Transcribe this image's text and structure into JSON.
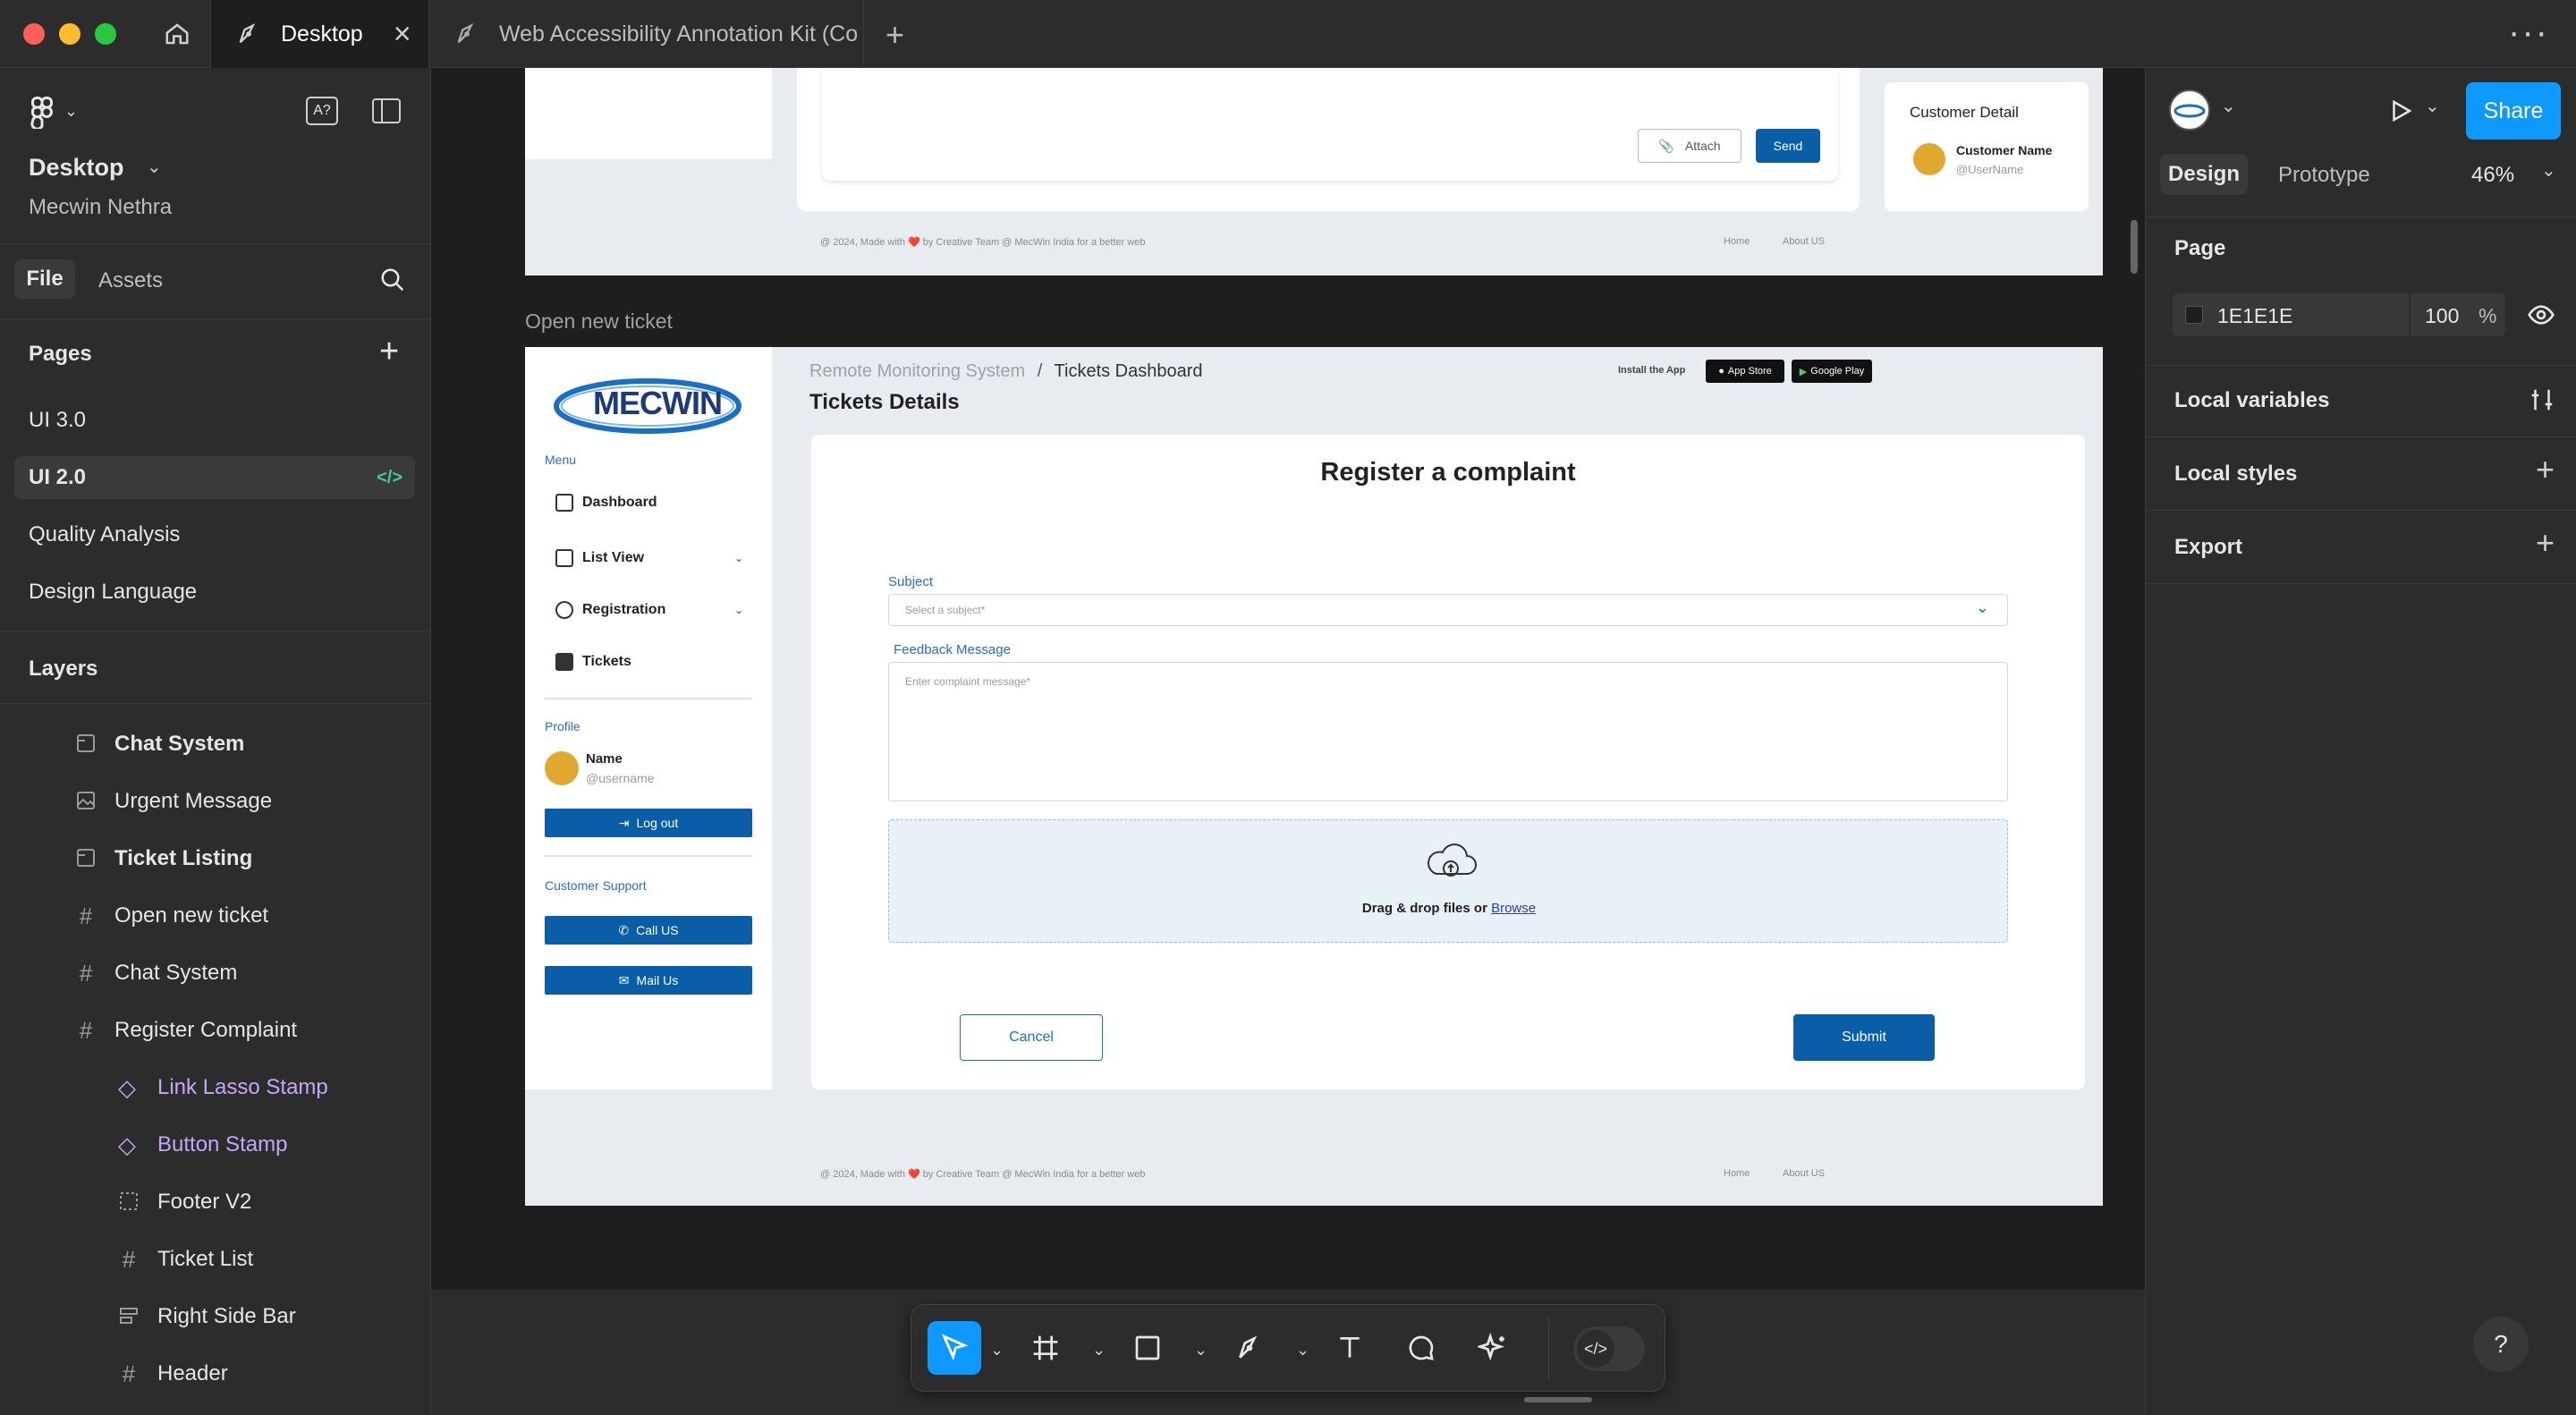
{
  "titlebar": {
    "tabs": [
      {
        "label": "Desktop"
      },
      {
        "label": "Web Accessibility Annotation Kit (Cor"
      }
    ]
  },
  "left_panel": {
    "file_name": "Desktop",
    "team": "Mecwin Nethra",
    "tab_file": "File",
    "tab_assets": "Assets",
    "pages_title": "Pages",
    "pages": [
      "UI 3.0",
      "UI 2.0",
      "Quality Analysis",
      "Design Language"
    ],
    "layers_title": "Layers",
    "layers": [
      {
        "label": "Chat System",
        "bold": true,
        "icon": "section-icon"
      },
      {
        "label": "Urgent Message",
        "bold": false,
        "icon": "image-icon"
      },
      {
        "label": "Ticket Listing",
        "bold": true,
        "icon": "section-icon"
      },
      {
        "label": "Open new ticket",
        "bold": false,
        "icon": "frame-icon"
      },
      {
        "label": "Chat System",
        "bold": false,
        "icon": "frame-icon"
      },
      {
        "label": "Register Complaint",
        "bold": false,
        "icon": "frame-icon"
      },
      {
        "label": "Link Lasso Stamp",
        "bold": false,
        "icon": "component-instance-icon"
      },
      {
        "label": "Button Stamp",
        "bold": false,
        "icon": "component-instance-icon"
      },
      {
        "label": "Footer V2",
        "bold": false,
        "icon": "dashed-frame-icon"
      },
      {
        "label": "Ticket List",
        "bold": false,
        "icon": "frame-icon"
      },
      {
        "label": "Right Side Bar",
        "bold": false,
        "icon": "auto-layout-icon"
      },
      {
        "label": "Header",
        "bold": false,
        "icon": "frame-icon"
      }
    ]
  },
  "right_panel": {
    "share": "Share",
    "tab_design": "Design",
    "tab_prototype": "Prototype",
    "zoom": "46%",
    "page_title": "Page",
    "page_color": "1E1E1E",
    "page_opacity": "100",
    "page_opacity_unit": "%",
    "local_variables": "Local variables",
    "local_styles": "Local styles",
    "export": "Export"
  },
  "canvas": {
    "frame_label": "Open new ticket",
    "top_frame": {
      "attach": "Attach",
      "send": "Send",
      "customer_detail": "Customer Detail",
      "customer_name": "Customer Name",
      "username": "@UserName",
      "footer_left": "@ 2024, Made with ❤️ by Creative Team @ MecWin India for a better web",
      "footer_home": "Home",
      "footer_about": "About US"
    },
    "ticket_frame": {
      "logo": "MECWIN",
      "breadcrumb_root": "Remote Monitoring System",
      "breadcrumb_sep": "/",
      "breadcrumb_current": "Tickets Dashboard",
      "heading": "Tickets Details",
      "install": "Install the App",
      "app_store": "App Store",
      "google_play": "Google Play",
      "menu_title": "Menu",
      "menu": [
        "Dashboard",
        "List View",
        "Registration",
        "Tickets"
      ],
      "profile_title": "Profile",
      "profile_name": "Name",
      "profile_user": "@username",
      "logout": "Log out",
      "support_title": "Customer Support",
      "call": "Call US",
      "mail": "Mail Us",
      "form_title": "Register a complaint",
      "subject_label": "Subject",
      "subject_placeholder": "Select a subject*",
      "feedback_label": "Feedback Message",
      "feedback_placeholder": "Enter complaint message*",
      "drop_text": "Drag & drop files or ",
      "browse": "Browse",
      "cancel": "Cancel",
      "submit": "Submit",
      "footer_left": "@ 2024, Made with ❤️ by Creative Team @ MecWin India for a better web",
      "footer_home": "Home",
      "footer_about": "About US"
    }
  },
  "colors": {
    "accent": "#0d99ff",
    "brand_blue": "#0a5ea8",
    "canvas_bg": "#1e1e1e",
    "panel_bg": "#2c2c2c",
    "component_purple": "#c7a6f5"
  }
}
